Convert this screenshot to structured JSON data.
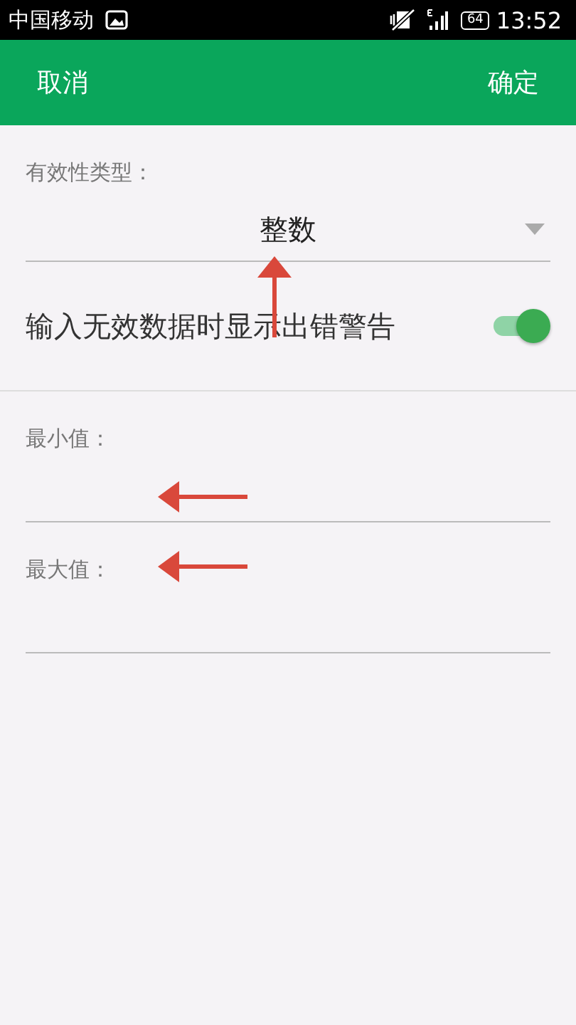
{
  "status_bar": {
    "carrier": "中国移动",
    "battery": "64",
    "time": "13:52"
  },
  "header": {
    "cancel": "取消",
    "confirm": "确定"
  },
  "validity_type": {
    "label": "有效性类型：",
    "value": "整数"
  },
  "error_alert": {
    "label": "输入无效数据时显示出错警告",
    "on": true
  },
  "fields": [
    {
      "label": "最小值："
    },
    {
      "label": "最大值："
    }
  ],
  "annotation_arrows": [
    {
      "kind": "up"
    },
    {
      "kind": "left"
    },
    {
      "kind": "left"
    }
  ]
}
